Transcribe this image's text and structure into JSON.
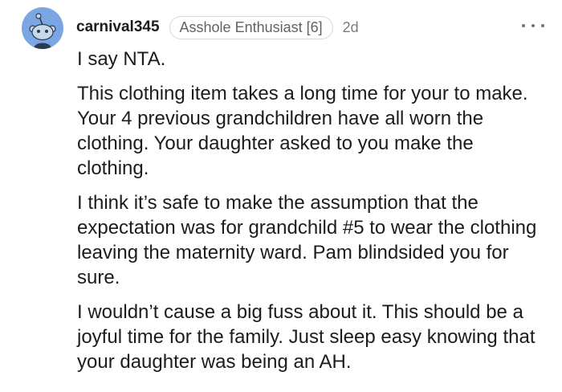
{
  "comment": {
    "username": "carnival345",
    "flair": "Asshole Enthusiast [6]",
    "age": "2d",
    "avatar_icon": "snoo-avatar-icon",
    "avatar_color": "#7aa6e4",
    "more_icon": "more-options-icon",
    "paragraphs": [
      "I say NTA.",
      "This clothing item takes a long time for your to make. Your 4 previous grandchildren have all worn the clothing. Your daughter asked to you make the clothing.",
      "I think it’s safe to make the assumption that the expectation was for grandchild #5 to wear the clothing leaving the maternity ward. Pam blindsided you for sure.",
      "I wouldn’t cause a big fuss about it. This should be a joyful time for the family. Just sleep easy knowing that your daughter was being an AH."
    ]
  }
}
